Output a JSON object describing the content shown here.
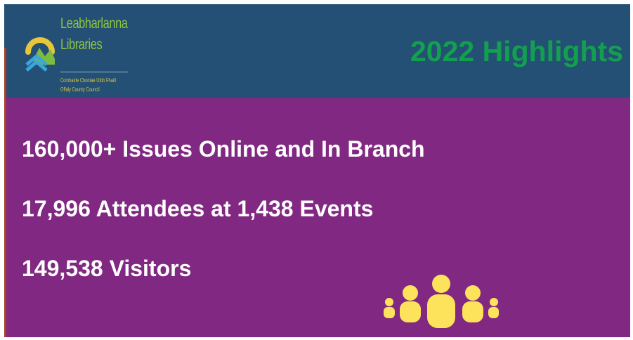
{
  "logo": {
    "name_line1": "Leabharlanna",
    "name_line2": "Libraries",
    "council_irish": "Comhairle Chontae Uíbh Fhailí",
    "council_english": "Offaly County Council"
  },
  "header": {
    "title": "2022 Highlights"
  },
  "highlights": [
    {
      "text": "160,000+ Issues Online and In Branch"
    },
    {
      "text": "17,996 Attendees at 1,438 Events"
    },
    {
      "text": "149,538 Visitors"
    }
  ],
  "icons": {
    "logo_mark": "leabharlanna-logo-icon",
    "people": "people-group-icon"
  },
  "colors": {
    "header_bg": "#245075",
    "body_bg": "#812882",
    "title": "#12a04f",
    "logo_green": "#8fc63e",
    "logo_yellow": "#d9c64a",
    "logo_blue": "#3aa6dd",
    "people_yellow": "#fde25c",
    "text": "#ffffff"
  }
}
